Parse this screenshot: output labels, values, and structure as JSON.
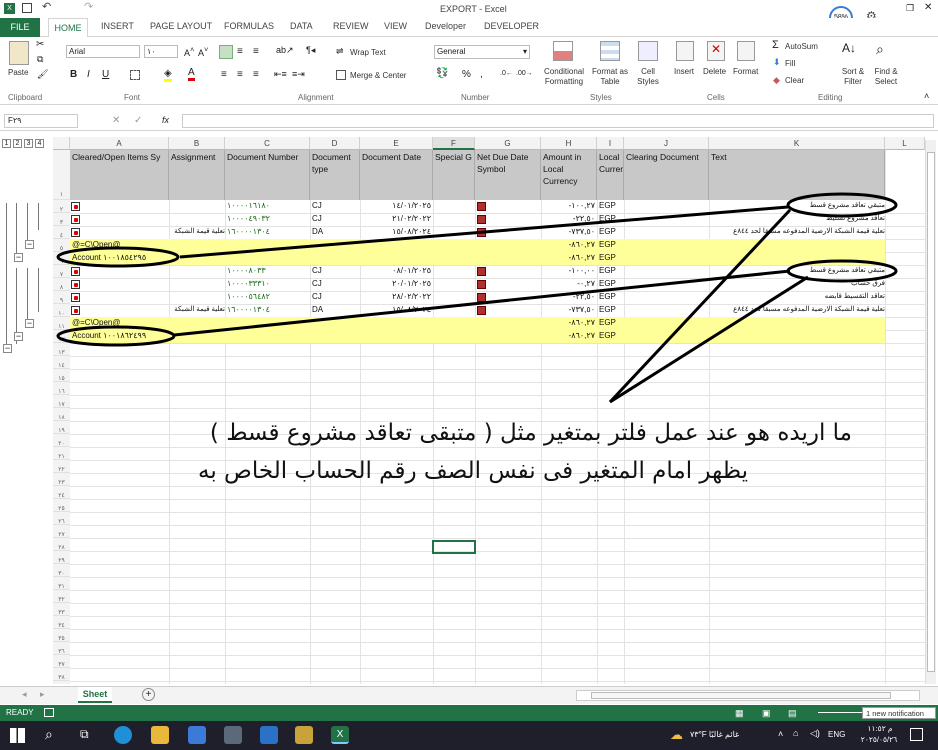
{
  "window": {
    "title": "EXPORT - Excel",
    "autosave": "58%",
    "account": "nt"
  },
  "tabs": [
    "FILE",
    "HOME",
    "INSERT",
    "PAGE LAYOUT",
    "FORMULAS",
    "DATA",
    "REVIEW",
    "VIEW",
    "Developer",
    "DEVELOPER"
  ],
  "ribbon": {
    "clipboard": {
      "label": "Clipboard",
      "paste": "Paste"
    },
    "font": {
      "label": "Font",
      "name": "Arial",
      "size": "١٠"
    },
    "alignment": {
      "label": "Alignment",
      "wrap": "Wrap Text",
      "merge": "Merge & Center"
    },
    "number": {
      "label": "Number",
      "format": "General"
    },
    "styles": {
      "label": "Styles",
      "conditional": "Conditional Formatting",
      "format_table": "Format as Table",
      "cell_styles": "Cell Styles"
    },
    "cells": {
      "label": "Cells",
      "insert": "Insert",
      "delete": "Delete",
      "format": "Format"
    },
    "editing": {
      "label": "Editing",
      "autosum": "AutoSum",
      "fill": "Fill",
      "clear": "Clear",
      "sort": "Sort & Filter",
      "find": "Find & Select"
    }
  },
  "formula_bar": {
    "name_box": "F٢٩",
    "fx": "fx",
    "content": ""
  },
  "outline_levels": [
    "1",
    "2",
    "3",
    "4"
  ],
  "columns": [
    "A",
    "B",
    "C",
    "D",
    "E",
    "F",
    "G",
    "H",
    "I",
    "J",
    "K",
    "L"
  ],
  "headers": {
    "A": "Cleared/Open Items Sy",
    "B": "Assignment",
    "C": "Document Number",
    "D": "Document type",
    "E": "Document Date",
    "F": "Special G",
    "G": "Net Due Date Symbol",
    "H": "Amount in Local Currency",
    "I": "Local Currency",
    "J": "Clearing Document",
    "K": "Text"
  },
  "rows": [
    {
      "num": "٢",
      "assignment": "",
      "doc": "١٠٠٠٠١٦١٨٠",
      "type": "CJ",
      "date": "١٤/٠١/٢٠٢٥",
      "amount": "-١٠٠,٢٧",
      "cur": "EGP",
      "text": "متبقي تعاقد مشروع قسط"
    },
    {
      "num": "٣",
      "assignment": "",
      "doc": "١٠٠٠٠٤٩٠٣٢",
      "type": "CJ",
      "date": "٢١/٠٢/٢٠٢٢",
      "amount": "-٢٢,٥٠",
      "cur": "EGP",
      "text": "تعاقد مشروع تسليط"
    },
    {
      "num": "٤",
      "assignment": "تعلية قيمة الشبكة",
      "doc": "١٦٠٠٠٠١٣٠٤",
      "type": "DA",
      "date": "١٥/٠٨/٢٠٢٤",
      "amount": "-٧٣٧,٥٠",
      "cur": "EGP",
      "text": "تعلية قيمة الشبكة الارضية المدفوعه مسبقا لحد ٨٤٤ع"
    },
    {
      "num": "٥",
      "label": "@=C\\Open@",
      "amount": "-٨٦٠,٢٧",
      "cur": "EGP",
      "yellow": true
    },
    {
      "num": "٦",
      "label": "Account ١٠٠١٨٥٤٢٩٥",
      "amount": "-٨٦٠,٢٧",
      "cur": "EGP",
      "yellow": true
    },
    {
      "num": "٧",
      "assignment": "",
      "doc": "١٠٠٠٠٨٠٣٣",
      "type": "CJ",
      "date": "٠٨/٠١/٢٠٢٥",
      "amount": "-١٠٠,٠٠",
      "cur": "EGP",
      "text": "متبقي تعاقد مشروع قسط"
    },
    {
      "num": "٨",
      "assignment": "",
      "doc": "١٠٠٠٠٣٣٣١٠",
      "type": "CJ",
      "date": "٢٠/٠١/٢٠٢٥",
      "amount": "-٠,٢٧",
      "cur": "EGP",
      "text": "فرق حساب"
    },
    {
      "num": "٩",
      "assignment": "",
      "doc": "١٠٠٠٠٥٦٤٨٢",
      "type": "CJ",
      "date": "٢٨/٠٢/٢٠٢٢",
      "amount": "-٢٢,٥٠",
      "cur": "EGP",
      "text": "تعاقد التقسيط قابضه"
    },
    {
      "num": "١٠",
      "assignment": "تعلية قيمة الشبكة",
      "doc": "١٦٠٠٠٠١٣٠٤",
      "type": "DA",
      "date": "١٥/٠٨/٢٠٢٤",
      "amount": "-٧٣٧,٥٠",
      "cur": "EGP",
      "text": "تعلية قيمة الشبكة الارضية المدفوعه مسبقا لحد ٨٤٤ع"
    },
    {
      "num": "١١",
      "label": "@=C\\Open@",
      "amount": "-٨٦٠,٢٧",
      "cur": "EGP",
      "yellow": true
    },
    {
      "num": "١٢",
      "label": "Account ١٠٠١٨٦٢٤٩٩",
      "amount": "-٨٦٠,٢٧",
      "cur": "EGP",
      "yellow": true
    }
  ],
  "empty_rows": [
    "١٣",
    "١٤",
    "١٥",
    "١٦",
    "١٧",
    "١٨",
    "١٩",
    "٢٠",
    "٢١",
    "٢٢",
    "٢٣",
    "٢٤",
    "٢٥",
    "٢٦",
    "٢٧",
    "٢٨",
    "٢٩",
    "٣٠",
    "٣١",
    "٣٢",
    "٣٣",
    "٣٤",
    "٣٥",
    "٣٦",
    "٣٧",
    "٣٨",
    "٣٩"
  ],
  "overlay": {
    "line1": "ما اريده هو عند عمل فلتر بمتغير مثل ( متبقى تعاقد مشروع قسط )",
    "line2": "يظهر امام المتغير فى نفس الصف رقم الحساب الخاص به"
  },
  "sheet_tab": "Sheet",
  "status": {
    "ready": "READY",
    "notification": "1 new notification"
  },
  "taskbar": {
    "weather": "٧٣°F غائم غالبًا",
    "lang": "ENG",
    "time": "م ١١:٥٢",
    "date": "٢٠٢٥/٠٥/٢٦"
  }
}
